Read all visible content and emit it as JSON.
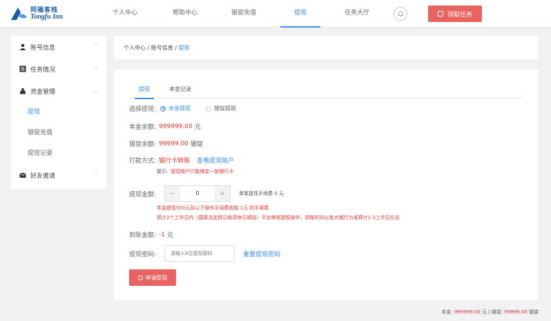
{
  "brand": {
    "name_cn": "同福客栈",
    "name_en": "Tongfu Inn"
  },
  "nav": {
    "items": [
      "个人中心",
      "帮助中心",
      "银锭充值",
      "提现",
      "任务大厅"
    ],
    "active_index": 3,
    "claim_label": "领取任务"
  },
  "sidebar": {
    "groups": [
      {
        "label": "账号信息",
        "icon": "user-icon"
      },
      {
        "label": "任务情况",
        "icon": "list-icon"
      },
      {
        "label": "资金管理",
        "icon": "money-bag-icon"
      }
    ],
    "subitems": [
      "提现",
      "银锭充值",
      "提现记录"
    ],
    "friends_label": "好友邀请"
  },
  "breadcrumb": {
    "prefix": "个人中心 / 账号信息 / ",
    "current": "提现"
  },
  "tabs": [
    "提现",
    "本金记录"
  ],
  "form": {
    "select_label": "选择提现:",
    "option_principal": "本金提现",
    "option_silver": "银锭提现",
    "principal_label": "本金余额:",
    "principal_value": "999999.00",
    "principal_unit": "元",
    "silver_label": "银锭余额:",
    "silver_value": "99999.00",
    "silver_unit": "银锭",
    "payment_label": "打款方式:",
    "payment_value": "银行卡转账",
    "view_account": "查看提现账户",
    "tip_label": "提示:",
    "tip_text": "提现账户只能绑定一张银行卡",
    "amount_label": "提现金额:",
    "amount_value": "0",
    "single_fee": "单笔提现手续费 0 元",
    "note1": "本金提现500元及以下操作手续费收取 1元 的手续费",
    "note2": "预计2个工作日内（国家法定假日和双休日顺延）平台审核提现操作，到账时间以各大银行为准预计1-3工作日左右",
    "arrival_label": "到账金额:",
    "arrival_value": "-1",
    "arrival_unit": "元",
    "password_label": "提现密码:",
    "password_placeholder": "请输入6位提现密码",
    "reset_label": "重置提现密码",
    "apply_label": "申请提现"
  },
  "footer": {
    "principal_label": "本金:",
    "principal_value": "999999.00",
    "principal_unit": "元 |",
    "silver_label": "银锭:",
    "silver_value": "99999.00",
    "silver_unit": "银锭"
  },
  "colors": {
    "accent": "#3a8ee6",
    "danger": "#e5322d",
    "button": "#e96460"
  }
}
